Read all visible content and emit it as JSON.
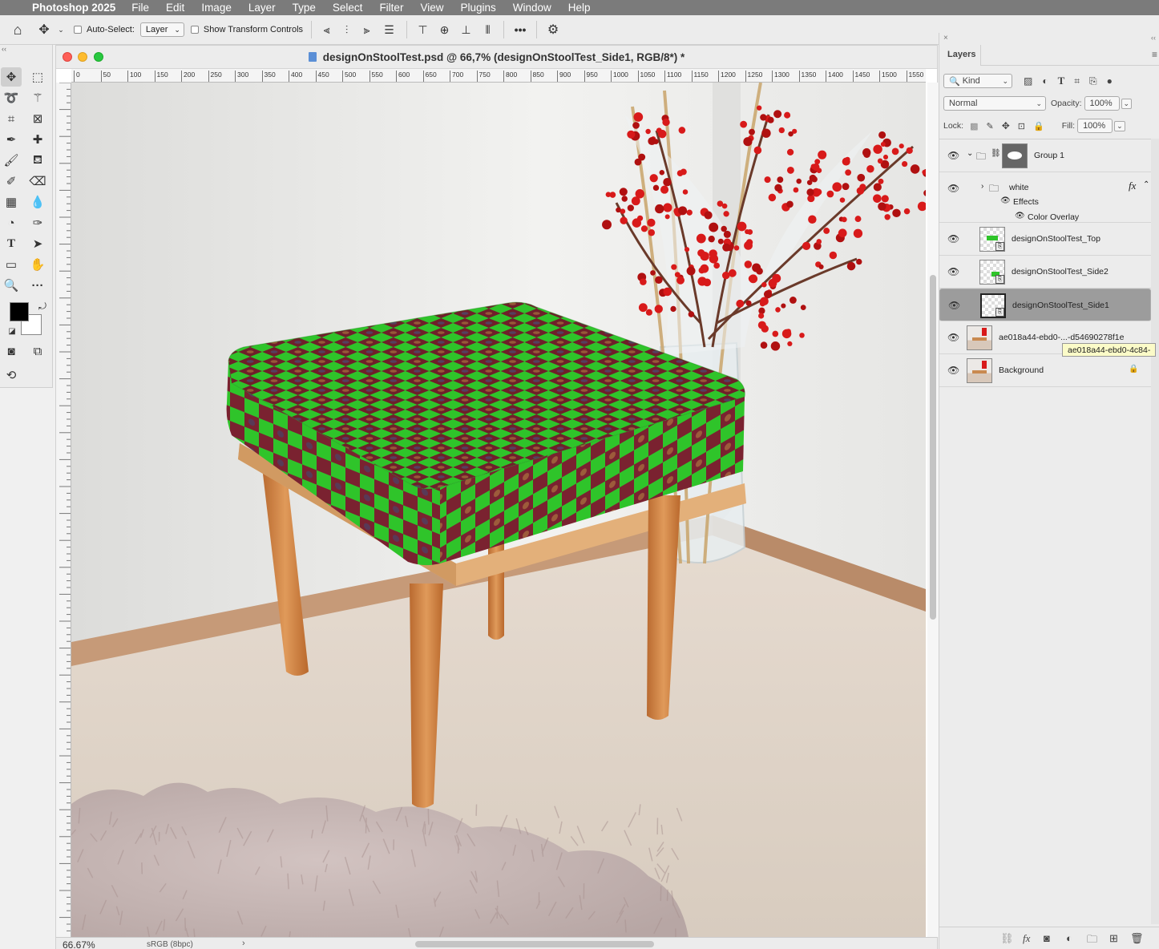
{
  "menubar": {
    "app_name": "Photoshop 2025",
    "items": [
      "File",
      "Edit",
      "Image",
      "Layer",
      "Type",
      "Select",
      "Filter",
      "View",
      "Plugins",
      "Window",
      "Help"
    ]
  },
  "options_bar": {
    "auto_select_label": "Auto-Select:",
    "auto_select_target": "Layer",
    "show_transform_label": "Show Transform Controls"
  },
  "document": {
    "title": "designOnStoolTest.psd @ 66,7% (designOnStoolTest_Side1, RGB/8*) *",
    "zoom": "66.67%",
    "color_profile": "sRGB (8bpc)",
    "ruler_marks": [
      "0",
      "50",
      "100",
      "150",
      "200",
      "250",
      "300",
      "350",
      "400",
      "450",
      "500",
      "550",
      "600",
      "650",
      "700",
      "750",
      "800",
      "850",
      "900",
      "950",
      "1000",
      "1050",
      "1100",
      "1150",
      "1200",
      "1250",
      "1300",
      "1350",
      "1400",
      "1450",
      "1500",
      "1550"
    ]
  },
  "layers_panel": {
    "tab_label": "Layers",
    "filter_kind": "Kind",
    "blend_mode": "Normal",
    "opacity_label": "Opacity:",
    "opacity_value": "100%",
    "lock_label": "Lock:",
    "fill_label": "Fill:",
    "fill_value": "100%",
    "layers": [
      {
        "name": "Group 1"
      },
      {
        "name": "white",
        "effects_label": "Effects",
        "effect": "Color Overlay"
      },
      {
        "name": "designOnStoolTest_Top"
      },
      {
        "name": "designOnStoolTest_Side2"
      },
      {
        "name": "designOnStoolTest_Side1",
        "selected": true
      },
      {
        "name": "ae018a44-ebd0-...-d54690278f1e"
      },
      {
        "name": "Background"
      }
    ],
    "tooltip": "ae018a44-ebd0-4c84-"
  },
  "colors": {
    "checker_green": "#2fc42a",
    "checker_maroon": "#6f1f2a",
    "stool_wood": "#d08a4a",
    "berries": "#d81a1a"
  }
}
